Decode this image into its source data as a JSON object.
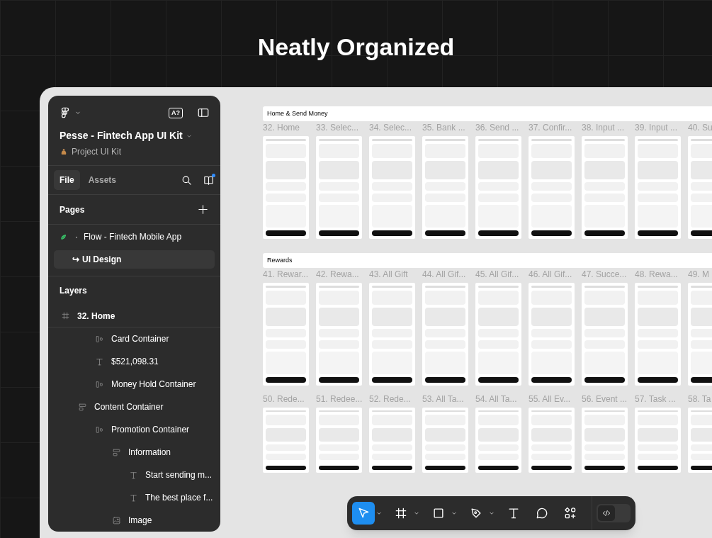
{
  "heading": "Neatly Organized",
  "sidebar": {
    "help_badge": "A?",
    "project_title": "Pesse - Fintech App UI Kit",
    "project_subtitle": "Project UI Kit",
    "tabs": [
      {
        "label": "File",
        "selected": true
      },
      {
        "label": "Assets",
        "selected": false
      }
    ],
    "notification": true,
    "pages_title": "Pages",
    "pages": [
      {
        "marker": "·",
        "label": "Flow - Fintech Mobile App",
        "kind": "flow",
        "selected": false
      },
      {
        "marker": "↪",
        "label": "UI Design",
        "kind": "design",
        "selected": true
      }
    ],
    "layers_title": "Layers",
    "layers": [
      {
        "name": "32. Home",
        "kind": "frame",
        "children": [
          {
            "children": [
              {
                "name": "Card Container",
                "kind": "row"
              },
              {
                "name": "$521,098.31",
                "kind": "text"
              },
              {
                "name": "Money Hold Container",
                "kind": "row"
              }
            ]
          },
          {
            "name": "Content Container",
            "kind": "column",
            "children": [
              {
                "name": "Promotion Container",
                "kind": "row",
                "children": [
                  {
                    "name": "Information",
                    "kind": "column",
                    "children": [
                      {
                        "name": "Start sending m...",
                        "kind": "text"
                      },
                      {
                        "name": "The best place f...",
                        "kind": "text"
                      }
                    ]
                  },
                  {
                    "name": "Image",
                    "kind": "image"
                  }
                ]
              }
            ]
          }
        ]
      }
    ]
  },
  "canvas": {
    "sections": [
      {
        "title": "Home & Send Money",
        "frames": [
          "32. Home",
          "33. Selec...",
          "34. Selec...",
          "35. Bank ...",
          "36. Send ...",
          "37. Confir...",
          "38. Input ...",
          "39. Input ...",
          "40. Su"
        ]
      },
      {
        "title": "Rewards",
        "frames": [
          "41. Rewar...",
          "42. Rewa...",
          "43. All Gift",
          "44. All Gif...",
          "45. All Gif...",
          "46. All Gif...",
          "47. Succe...",
          "48. Rewa...",
          "49. M",
          "50. Rede...",
          "51. Redee...",
          "52. Rede...",
          "53. All Ta...",
          "54. All Ta...",
          "55. All Ev...",
          "56. Event ...",
          "57. Task ...",
          "58. Ta"
        ]
      }
    ]
  },
  "toolbar": {
    "tools": [
      {
        "kind": "move",
        "selected": true,
        "menu": true
      },
      {
        "kind": "frame",
        "selected": false,
        "menu": true
      },
      {
        "kind": "rectangle",
        "selected": false,
        "menu": true
      },
      {
        "kind": "pen",
        "selected": false,
        "menu": true
      },
      {
        "kind": "text",
        "selected": false,
        "menu": false
      },
      {
        "kind": "comment",
        "selected": false,
        "menu": false
      },
      {
        "kind": "components",
        "selected": false,
        "menu": false
      }
    ],
    "dev_mode_on": false
  }
}
